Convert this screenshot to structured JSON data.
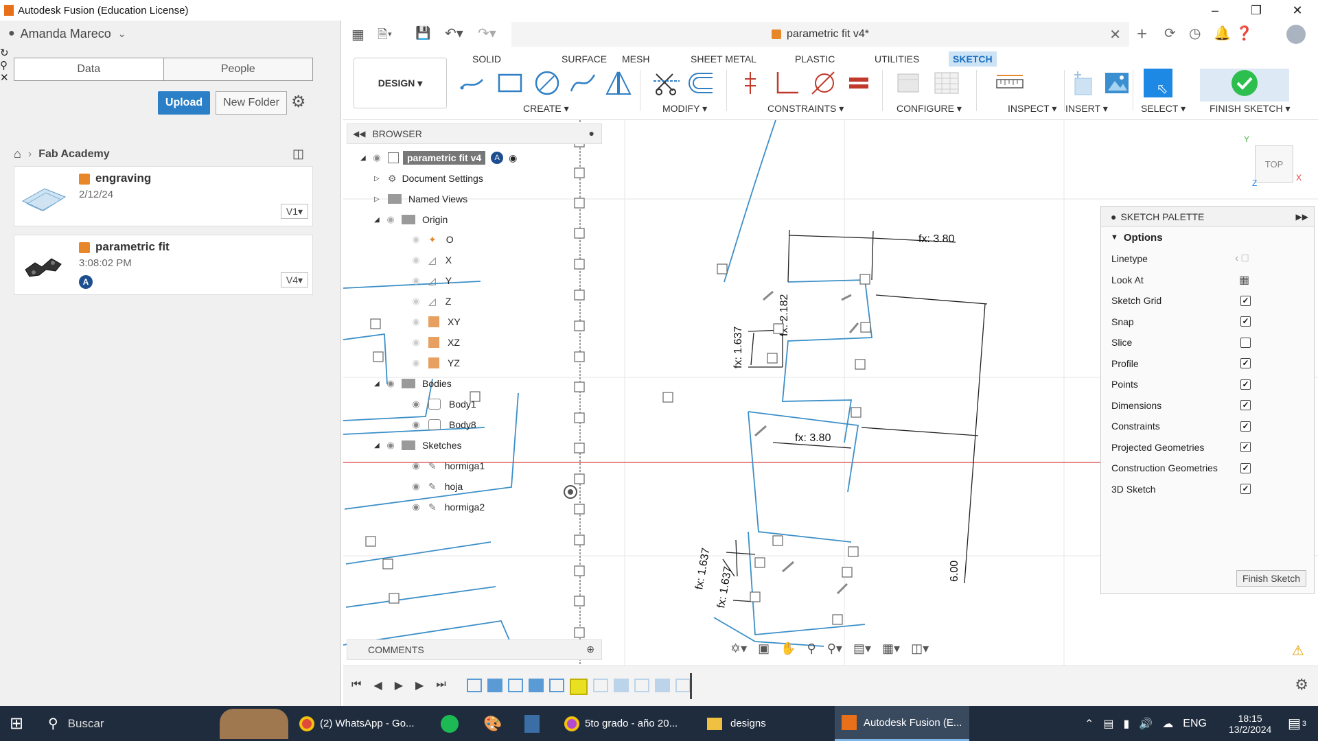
{
  "window": {
    "title": "Autodesk Fusion (Education License)"
  },
  "user": {
    "name": "Amanda Mareco"
  },
  "data_panel": {
    "tabs": [
      "Data",
      "People"
    ],
    "upload_label": "Upload",
    "new_folder_label": "New Folder",
    "breadcrumb": "Fab Academy",
    "files": [
      {
        "name": "engraving",
        "date": "2/12/24",
        "version": "V1"
      },
      {
        "name": "parametric fit",
        "date": "3:08:02 PM",
        "version": "V4",
        "badge": "A"
      }
    ]
  },
  "doc_tab": {
    "title": "parametric fit v4*"
  },
  "ribbon": {
    "tabs": [
      "SOLID",
      "SURFACE",
      "MESH",
      "SHEET METAL",
      "PLASTIC",
      "UTILITIES",
      "SKETCH"
    ],
    "active_tab": "SKETCH",
    "design_label": "DESIGN",
    "groups": {
      "create": "CREATE",
      "modify": "MODIFY",
      "constraints": "CONSTRAINTS",
      "configure": "CONFIGURE",
      "inspect": "INSPECT",
      "insert": "INSERT",
      "select": "SELECT",
      "finish": "FINISH SKETCH"
    }
  },
  "browser": {
    "title": "BROWSER",
    "root": "parametric fit v4",
    "items": {
      "doc_settings": "Document Settings",
      "named_views": "Named Views",
      "origin": "Origin",
      "o": "O",
      "x": "X",
      "y": "Y",
      "z": "Z",
      "xy": "XY",
      "xz": "XZ",
      "yz": "YZ",
      "bodies": "Bodies",
      "body1": "Body1",
      "body8": "Body8",
      "sketches": "Sketches",
      "sk1": "hormiga1",
      "sk2": "hoja",
      "sk3": "hormiga2"
    },
    "comments": "COMMENTS"
  },
  "viewcube": {
    "label": "TOP",
    "axes": [
      "Y",
      "X",
      "Z"
    ]
  },
  "dimensions": {
    "d1": "fx: 3.80",
    "d2": "fx: 3.80",
    "d3": "fx: 1.637",
    "d4": "fx: 2.182",
    "d5": "fx: 1.637",
    "d6": "fx: 1.637",
    "d7": "6.00"
  },
  "sketch_palette": {
    "title": "SKETCH PALETTE",
    "section": "Options",
    "rows": [
      {
        "label": "Linetype",
        "type": "icons"
      },
      {
        "label": "Look At",
        "type": "icon"
      },
      {
        "label": "Sketch Grid",
        "checked": true
      },
      {
        "label": "Snap",
        "checked": true
      },
      {
        "label": "Slice",
        "checked": false
      },
      {
        "label": "Profile",
        "checked": true
      },
      {
        "label": "Points",
        "checked": true
      },
      {
        "label": "Dimensions",
        "checked": true
      },
      {
        "label": "Constraints",
        "checked": true
      },
      {
        "label": "Projected Geometries",
        "checked": true
      },
      {
        "label": "Construction Geometries",
        "checked": true
      },
      {
        "label": "3D Sketch",
        "checked": true
      }
    ],
    "finish_label": "Finish Sketch"
  },
  "taskbar": {
    "search": "Buscar",
    "apps": {
      "whatsapp": "(2) WhatsApp - Go...",
      "chrome2": "5to grado - año 20...",
      "explorer": "designs",
      "fusion": "Autodesk Fusion (E..."
    },
    "lang": "ENG",
    "time": "18:15",
    "date": "13/2/2024",
    "notif_count": "3"
  },
  "colors": {
    "accent": "#1a6fc0",
    "sketch_line": "#3b8fc8",
    "axis_red": "#e06060",
    "finish_green": "#2dbf4e",
    "taskbar": "#1f2c3d"
  }
}
